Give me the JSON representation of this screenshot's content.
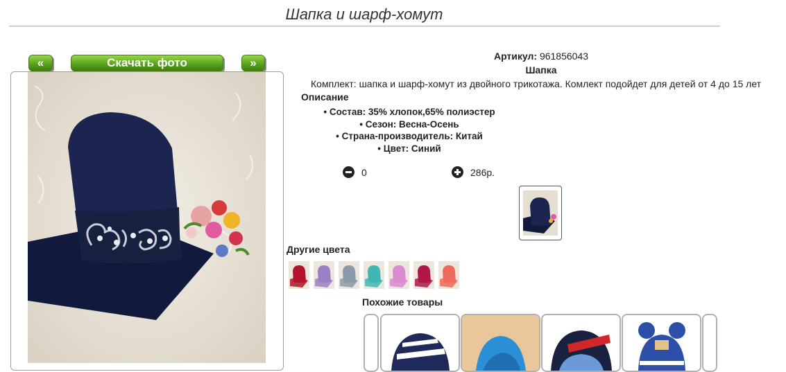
{
  "page": {
    "title": "Шапка и шарф-хомут"
  },
  "gallery": {
    "prev_label": "«",
    "download_label": "Скачать фото",
    "next_label": "»"
  },
  "product": {
    "article_label": "Артикул:",
    "article": "961856043",
    "name": "Шапка",
    "description": "Комплект: шапка и шарф-хомут из двойного трикотажа. Комлект подойдет для детей от 4 до 15 лет",
    "description_heading": "Описание",
    "specs": [
      "Состав: 35% хлопок,65% полиэстер",
      "Сезон: Весна-Осень",
      "Страна-производитель: Китай",
      "Цвет: Синий"
    ],
    "quantity": "0",
    "price": "286р."
  },
  "other_colors": {
    "heading": "Другие цвета",
    "swatches": [
      "#b3122a",
      "#9b7fc4",
      "#8a9aa8",
      "#3fb7b4",
      "#d98ad1",
      "#b01748",
      "#ee6a5c"
    ]
  },
  "similar": {
    "heading": "Похожие товары"
  },
  "colors": {
    "button_green": "#5aa31c",
    "hat_navy": "#1b2550"
  }
}
